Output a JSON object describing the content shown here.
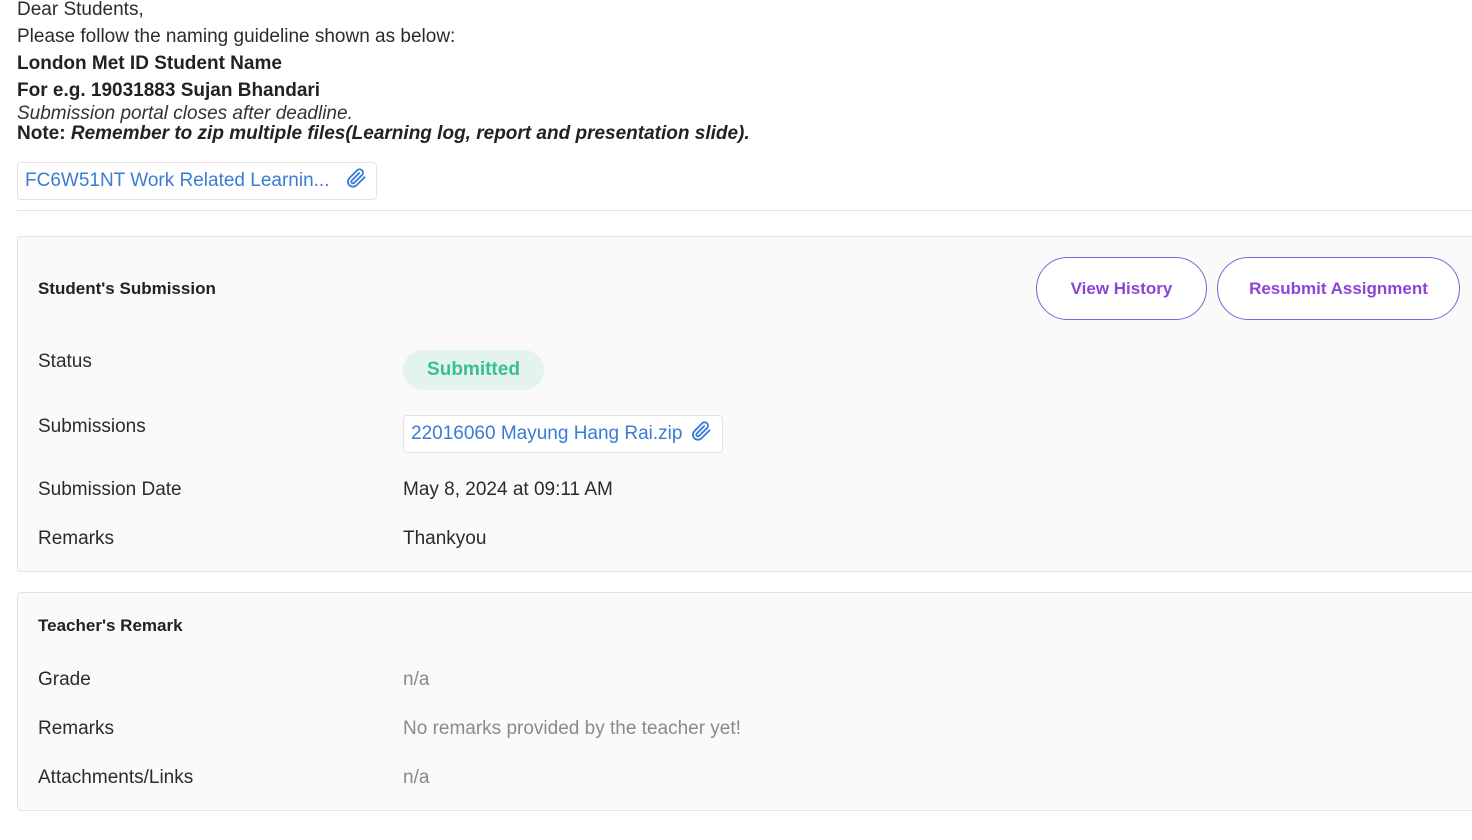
{
  "instructions": {
    "greeting": "Dear Students,",
    "guideline": "Please follow the naming guideline shown as below:",
    "format": "London Met ID Student Name",
    "example": "For e.g. 19031883 Sujan Bhandari",
    "deadline": "Submission portal closes after deadline.",
    "note_label": "Note:",
    "note_text": "Remember to zip multiple files(Learning log, report and presentation slide)."
  },
  "assignment_attachment": {
    "label": "FC6W51NT Work Related Learnin...",
    "icon": "paperclip-icon"
  },
  "submission": {
    "title": "Student's Submission",
    "view_history_label": "View History",
    "resubmit_label": "Resubmit Assignment",
    "status_label": "Status",
    "status_value": "Submitted",
    "submissions_label": "Submissions",
    "file_name": "22016060 Mayung Hang Rai.zip",
    "date_label": "Submission Date",
    "date_value": "May 8, 2024 at 09:11 AM",
    "remarks_label": "Remarks",
    "remarks_value": "Thankyou"
  },
  "teacher": {
    "title": "Teacher's Remark",
    "grade_label": "Grade",
    "grade_value": "n/a",
    "remarks_label": "Remarks",
    "remarks_value": "No remarks provided by the teacher yet!",
    "attachments_label": "Attachments/Links",
    "attachments_value": "n/a"
  },
  "colors": {
    "accent_purple": "#8a45d8",
    "link_blue": "#3a7bd5",
    "status_green": "#3cbf8e",
    "status_green_bg": "#e3f3ee",
    "muted_text": "#8a8a8a"
  }
}
